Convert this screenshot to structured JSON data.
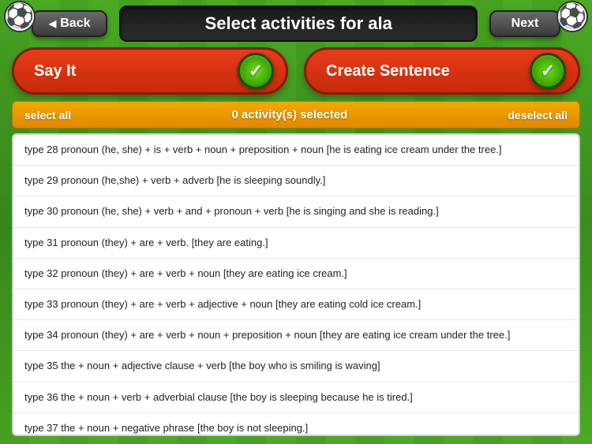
{
  "header": {
    "title": "Select activities for ala",
    "back_label": "Back",
    "next_label": "Next"
  },
  "activities": {
    "say_it_label": "Say It",
    "create_sentence_label": "Create Sentence"
  },
  "selection_bar": {
    "select_all_label": "select all",
    "count_label": "0 activity(s) selected",
    "deselect_all_label": "deselect all"
  },
  "list_items": [
    "type 28 pronoun (he, she) + is + verb + noun + preposition + noun [he is eating ice cream under the tree.]",
    "type 29 pronoun (he,she) + verb + adverb [he is sleeping soundly.]",
    "type 30 pronoun (he, she) + verb + and + pronoun + verb [he is singing and she is reading.]",
    "type 31 pronoun (they) + are + verb. [they are eating.]",
    "type 32 pronoun (they) + are + verb + noun [they are eating ice cream.]",
    "type 33 pronoun (they) + are + verb + adjective + noun [they are eating cold ice cream.]",
    "type 34 pronoun (they) + are + verb + noun + preposition + noun [they are eating ice cream under the tree.]",
    "type 35 the + noun + adjective clause + verb [the boy who is smiling is waving]",
    "type 36 the + noun + verb + adverbial clause [the boy is sleeping because he is tired.]",
    "type 37 the + noun + negative phrase [the boy is not sleeping.]"
  ]
}
